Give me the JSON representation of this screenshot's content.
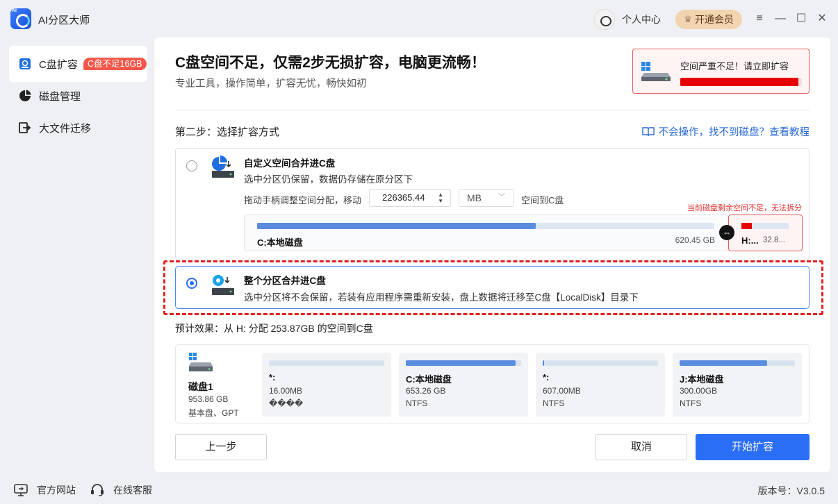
{
  "app": {
    "title": "AI分区大师",
    "logo_text": "AI"
  },
  "titlebar": {
    "user_center": "个人中心",
    "vip_button": "开通会员",
    "menu_icon": "≡",
    "minimize_icon": "—",
    "maximize_icon": "☐",
    "close_icon": "✕"
  },
  "sidebar": {
    "items": [
      {
        "label": "C盘扩容",
        "badge": "C盘不足16GB",
        "icon": "disk-plus-icon",
        "active": true
      },
      {
        "label": "磁盘管理",
        "icon": "pie-chart-icon",
        "active": false
      },
      {
        "label": "大文件迁移",
        "icon": "migrate-icon",
        "active": false
      }
    ]
  },
  "main": {
    "title": "C盘空间不足，仅需2步无损扩容，电脑更流畅！",
    "subtitle": "专业工具，操作简单，扩容无忧，畅快如初",
    "warning": {
      "text": "空间严重不足！请立即扩容",
      "fill_percent": 97,
      "color": "#e60000"
    },
    "step_label": "第二步：选择扩容方式",
    "help_link": "不会操作，找不到磁盘？查看教程",
    "option1": {
      "title": "自定义空间合并进C盘",
      "desc": "选中分区仍保留，数据仍存储在原分区下",
      "adjust_label": "拖动手柄调整空间分配，移动",
      "amount": "226365.44",
      "unit": "MB",
      "to_c": "空间到C盘",
      "error_note": "当前磁盘剩余空间不足，无法拆分",
      "c_drive": {
        "name": "C:本地磁盘",
        "size": "620.45 GB",
        "fill_percent": 61
      },
      "h_drive": {
        "name": "H:...",
        "size": "32.8...",
        "fill_percent": 22
      },
      "selected": false
    },
    "option2": {
      "title": "整个分区合并进C盘",
      "desc": "选中分区将不会保留，若装有应用程序需重新安装，盘上数据将迁移至C盘【LocalDisk】目录下",
      "selected": true
    },
    "forecast": "预计效果：从 H: 分配 253.87GB 的空间到C盘",
    "disk": {
      "name": "磁盘1",
      "size": "953.86 GB",
      "type": "基本盘、GPT",
      "partitions": [
        {
          "name": "*:",
          "size": "16.00MB",
          "fs": "����",
          "fill_percent": 0
        },
        {
          "name": "C:本地磁盘",
          "size": "653.26 GB",
          "fs": "NTFS",
          "fill_percent": 95
        },
        {
          "name": "*:",
          "size": "607.00MB",
          "fs": "NTFS",
          "fill_percent": 1
        },
        {
          "name": "J:本地磁盘",
          "size": "300.00GB",
          "fs": "NTFS",
          "fill_percent": 76
        }
      ]
    },
    "buttons": {
      "prev": "上一步",
      "cancel": "取消",
      "start": "开始扩容"
    }
  },
  "footer": {
    "website": "官方网站",
    "support": "在线客服",
    "version": "版本号：V3.0.5"
  },
  "colors": {
    "accent": "#2a6ef5",
    "danger": "#e60000",
    "bar": "#5a8cdf"
  }
}
